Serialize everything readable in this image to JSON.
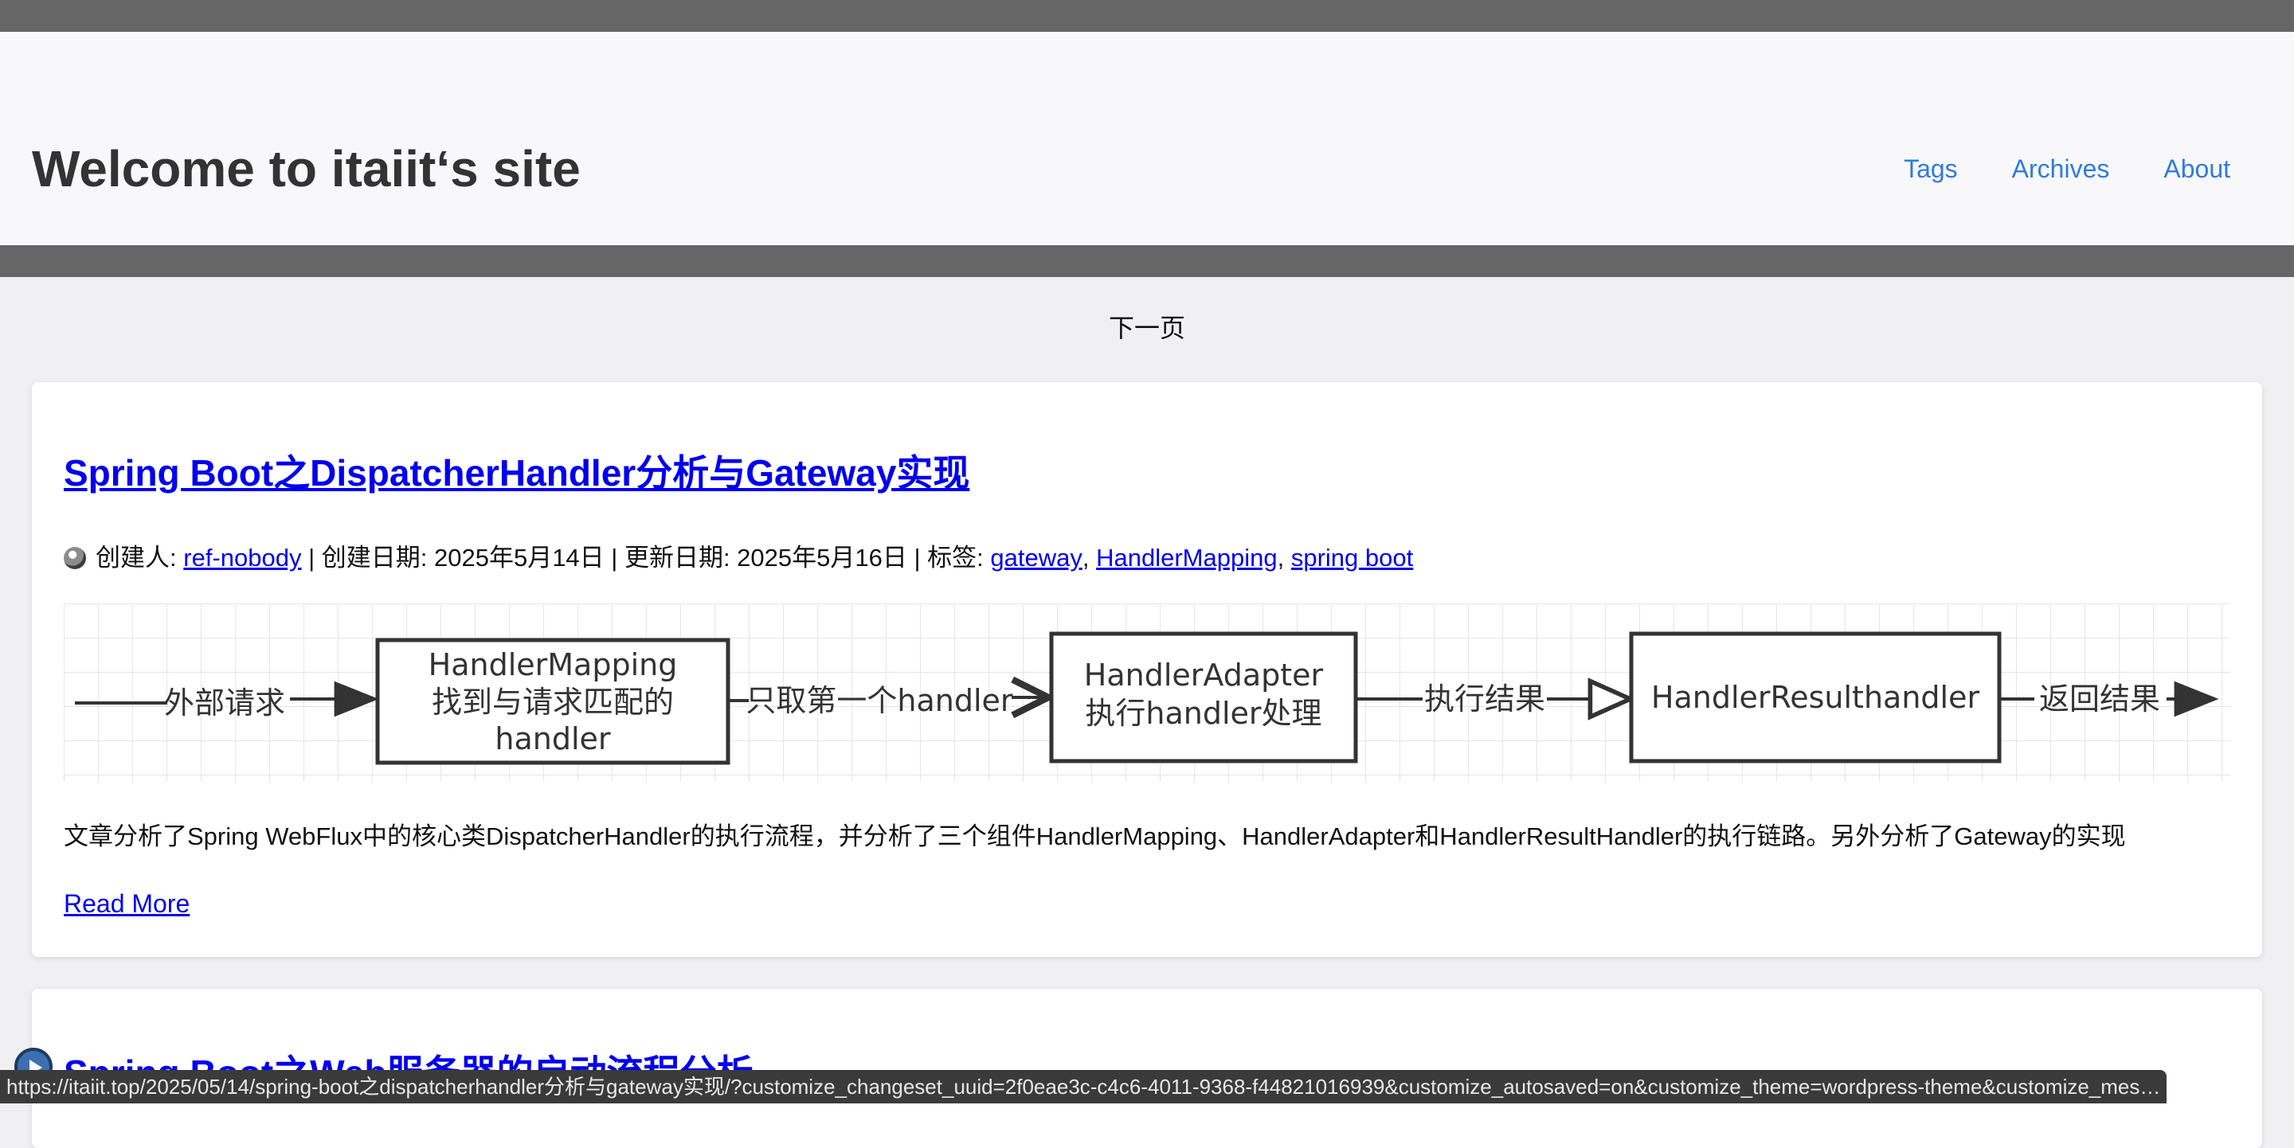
{
  "site": {
    "title": "Welcome to itaiit‘s site"
  },
  "nav": {
    "items": [
      "Tags",
      "Archives",
      "About"
    ]
  },
  "pagination": {
    "next_label": "下一页"
  },
  "posts": [
    {
      "title": "Spring Boot之DispatcherHandler分析与Gateway实现",
      "meta": {
        "creator_label": "创建人:",
        "creator": "ref-nobody",
        "created_label": "| 创建日期: 2025年5月14日 | 更新日期: 2025年5月16日 | 标签:",
        "tags": [
          "gateway",
          "HandlerMapping",
          "spring boot"
        ],
        "tag_separator": ","
      },
      "diagram": {
        "nodes": [
          {
            "line1": "HandlerMapping",
            "line2": "找到与请求匹配的",
            "line3": "handler"
          },
          {
            "line1": "HandlerAdapter",
            "line2": "执行handler处理"
          },
          {
            "line1": "HandlerResulthandler"
          }
        ],
        "edges": [
          "外部请求",
          "只取第一个handler",
          "执行结果",
          "返回结果"
        ]
      },
      "excerpt": "文章分析了Spring WebFlux中的核心类DispatcherHandler的执行流程，并分析了三个组件HandlerMapping、HandlerAdapter和HandlerResultHandler的执行链路。另外分析了Gateway的实现",
      "read_more": "Read More"
    },
    {
      "title": "Spring Boot之Web服务器的启动流程分析"
    }
  ],
  "status_bar": {
    "url": "https://itaiit.top/2025/05/14/spring-boot之dispatcherhandler分析与gateway实现/?customize_changeset_uuid=2f0eae3c-c4c6-4011-9368-f44821016939&customize_autosaved=on&customize_theme=wordpress-theme&customize_messenger_ch..."
  },
  "colors": {
    "link": "#0000ee",
    "nav_link": "#2f7bdc",
    "band": "#666666",
    "page_bg": "#f0f0f3"
  }
}
